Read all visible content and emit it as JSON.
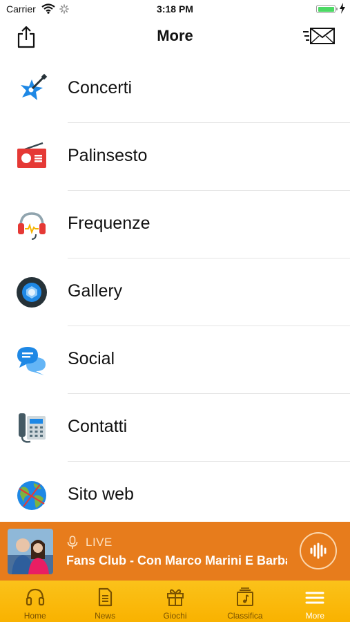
{
  "status_bar": {
    "carrier": "Carrier",
    "time": "3:18 PM"
  },
  "nav": {
    "title": "More",
    "left_icon": "share-icon",
    "right_icon": "mail-send-icon"
  },
  "menu": {
    "items": [
      {
        "label": "Concerti",
        "icon": "guitar-icon"
      },
      {
        "label": "Palinsesto",
        "icon": "radio-icon"
      },
      {
        "label": "Frequenze",
        "icon": "headphones-icon"
      },
      {
        "label": "Gallery",
        "icon": "camera-lens-icon"
      },
      {
        "label": "Social",
        "icon": "chat-bubbles-icon"
      },
      {
        "label": "Contatti",
        "icon": "telephone-icon"
      },
      {
        "label": "Sito web",
        "icon": "globe-icon"
      }
    ]
  },
  "player": {
    "live_label": "LIVE",
    "track_title": "Fans Club - Con Marco Marini E Barba",
    "accent_color": "#e77c1c"
  },
  "tabs": [
    {
      "label": "Home",
      "icon": "headphones-icon",
      "active": false
    },
    {
      "label": "News",
      "icon": "document-icon",
      "active": false
    },
    {
      "label": "Giochi",
      "icon": "gift-icon",
      "active": false
    },
    {
      "label": "Classifica",
      "icon": "music-album-icon",
      "active": false
    },
    {
      "label": "More",
      "icon": "menu-icon",
      "active": true
    }
  ],
  "colors": {
    "tab_bar": "#f9b200",
    "player": "#e77c1c",
    "divider": "#e3e3e3"
  }
}
